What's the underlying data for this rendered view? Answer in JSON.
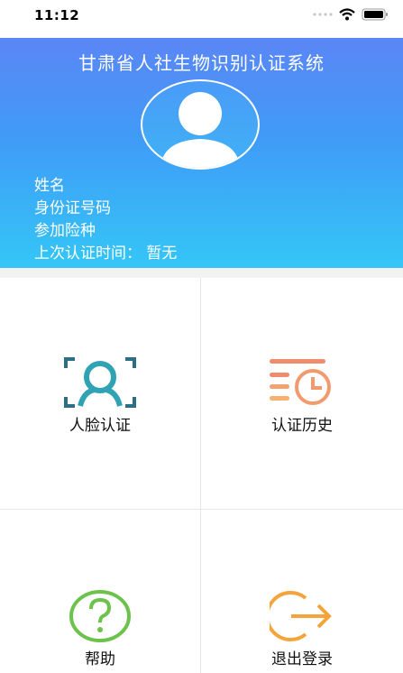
{
  "status_bar": {
    "time": "11:12"
  },
  "header": {
    "title": "甘肃省人社生物识别认证系统",
    "fields": {
      "name_label": "姓名",
      "id_label": "身份证号码",
      "insurance_label": "参加险种",
      "last_auth_label": "上次认证时间：",
      "last_auth_value": "暂无"
    }
  },
  "menu": {
    "face_auth": "人脸认证",
    "auth_history": "认证历史",
    "help": "帮助",
    "logout": "退出登录"
  },
  "colors": {
    "header_top": "#5b86f6",
    "header_bottom": "#34c6f6",
    "face_icon": "#2fa3b4",
    "history_icon": "#ee8a6a",
    "help_icon": "#6cc24a",
    "logout_icon": "#f5a43b"
  },
  "icons": [
    "wifi-icon",
    "battery-icon",
    "signal-icon",
    "avatar-icon",
    "face-scan-icon",
    "history-icon",
    "help-icon",
    "logout-icon"
  ]
}
